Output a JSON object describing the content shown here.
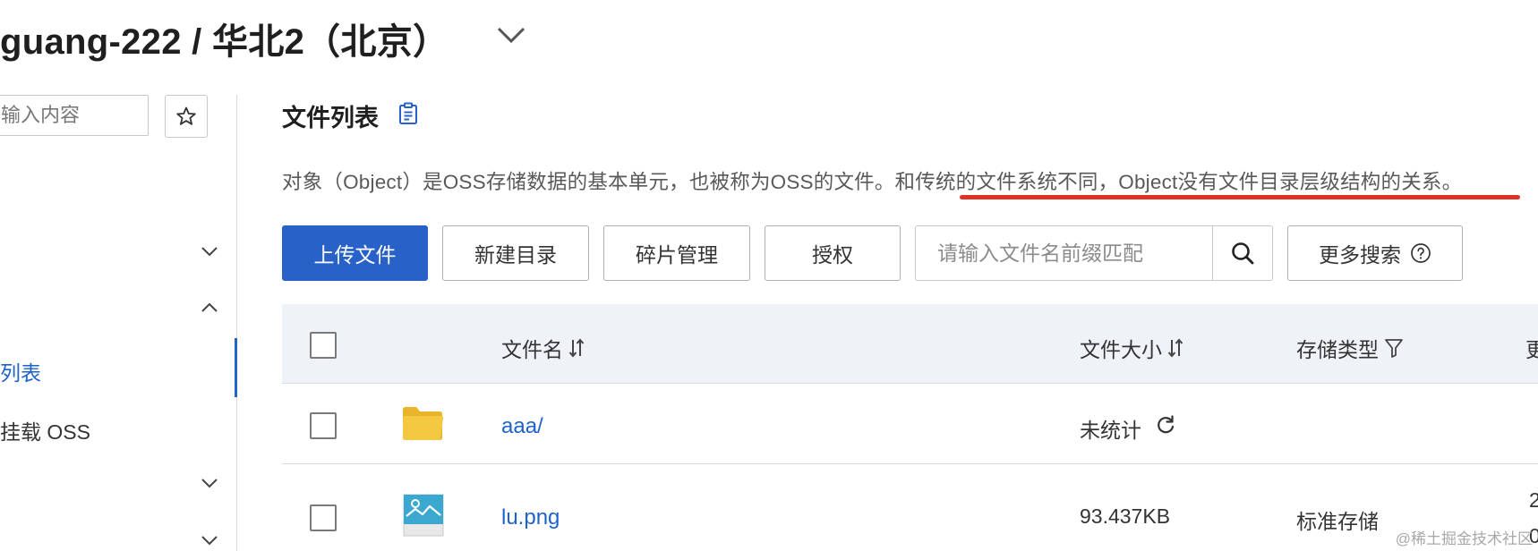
{
  "header": {
    "bucket_title": "guang-222 / 华北2（北京）"
  },
  "sidebar": {
    "search_placeholder": "输入内容",
    "items": [
      {
        "label": "列表",
        "active": true
      },
      {
        "label": "挂载 OSS",
        "active": false
      }
    ]
  },
  "main": {
    "title": "文件列表",
    "description": "对象（Object）是OSS存储数据的基本单元，也被称为OSS的文件。和传统的文件系统不同，Object没有文件目录层级结构的关系。",
    "toolbar": {
      "upload": "上传文件",
      "new_dir": "新建目录",
      "fragments": "碎片管理",
      "authorize": "授权",
      "search_placeholder": "请输入文件名前缀匹配",
      "more_search": "更多搜索"
    },
    "table": {
      "columns": {
        "name": "文件名",
        "size": "文件大小",
        "storage": "存储类型",
        "extra": "更"
      },
      "rows": [
        {
          "name": "aaa/",
          "type": "folder",
          "size": "未统计",
          "storage": ""
        },
        {
          "name": "lu.png",
          "type": "image",
          "size": "93.437KB",
          "storage": "标准存储",
          "extra_top": "2",
          "extra_bottom": "0"
        }
      ]
    }
  },
  "watermark": "@稀土掘金技术社区",
  "colors": {
    "primary": "#2862c8",
    "link": "#1e63c9",
    "highlight_underline": "#e03123",
    "table_header_bg": "#eff2f7",
    "folder": "#f5c842"
  },
  "icons": [
    "chevron-down-icon",
    "star-icon",
    "chevron-up-icon",
    "clipboard-icon",
    "search-icon",
    "help-circle-icon",
    "sort-icon",
    "filter-icon",
    "folder-icon",
    "refresh-icon",
    "image-file-icon"
  ]
}
